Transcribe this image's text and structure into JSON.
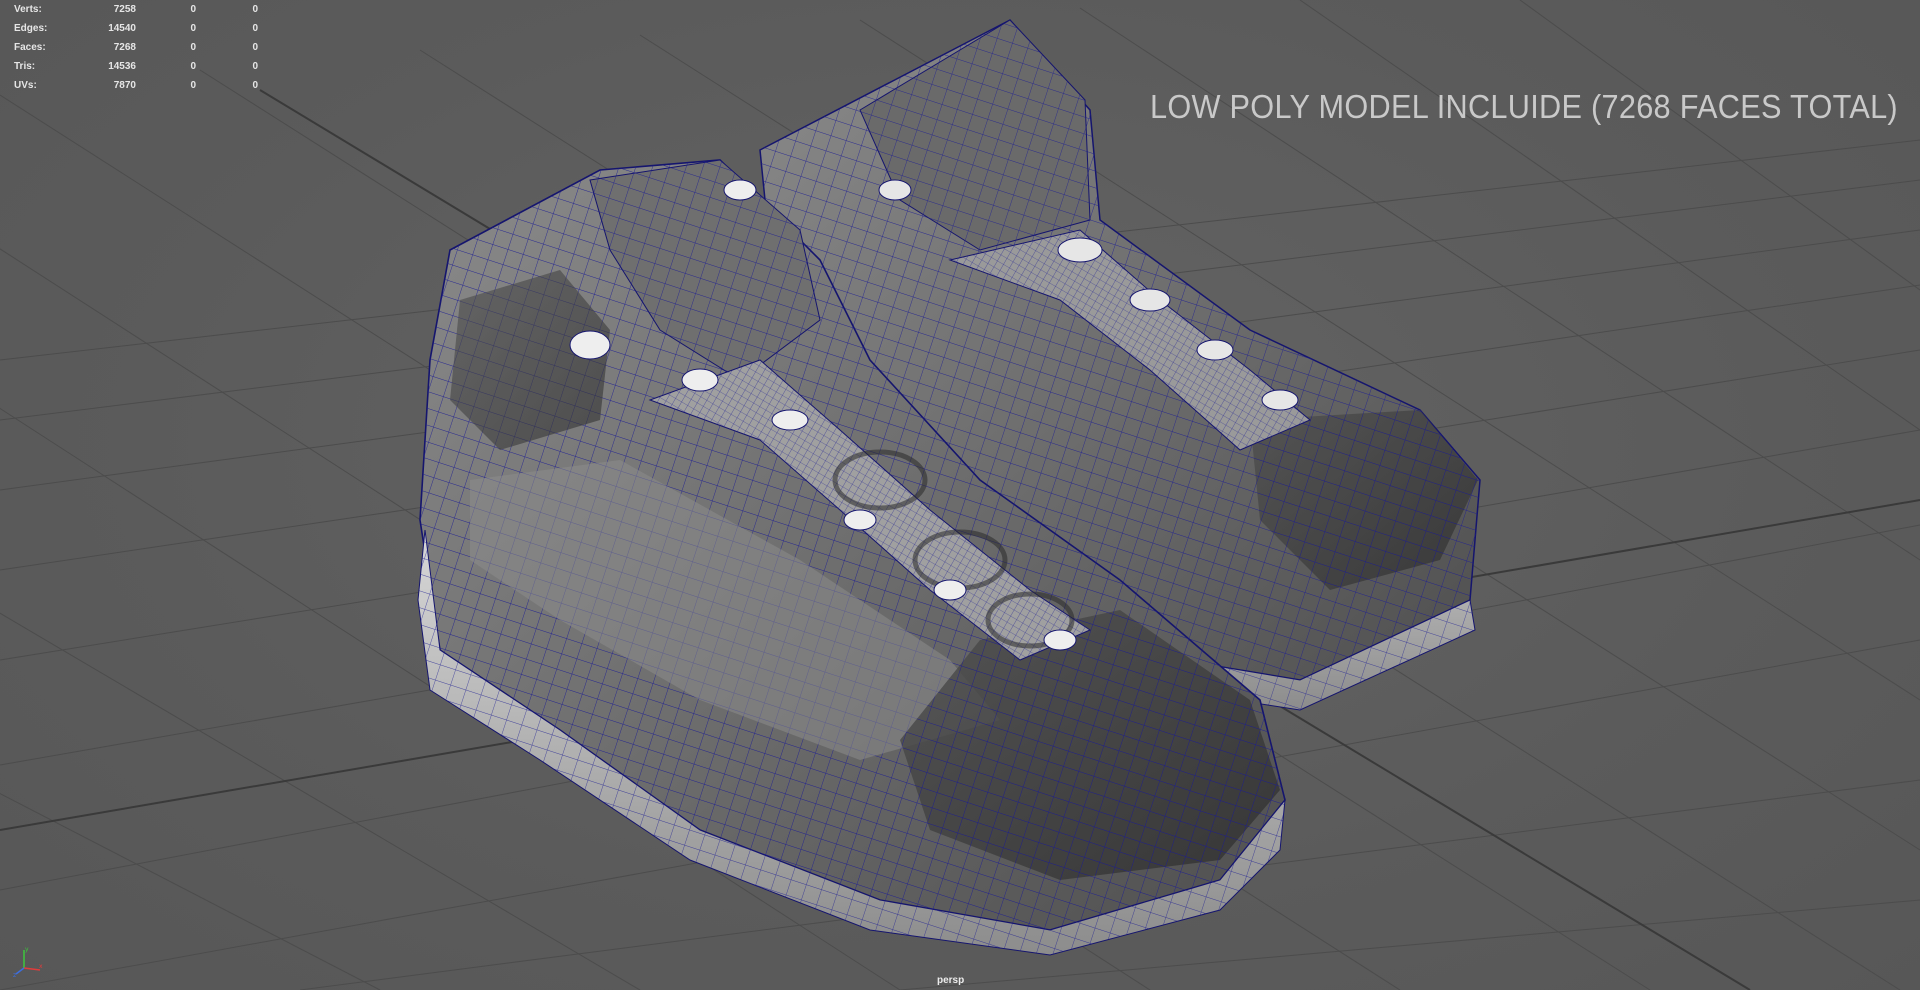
{
  "hud": {
    "rows": [
      {
        "label": "Verts:",
        "v0": "7258",
        "v1": "0",
        "v2": "0"
      },
      {
        "label": "Edges:",
        "v0": "14540",
        "v1": "0",
        "v2": "0"
      },
      {
        "label": "Faces:",
        "v0": "7268",
        "v1": "0",
        "v2": "0"
      },
      {
        "label": "Tris:",
        "v0": "14536",
        "v1": "0",
        "v2": "0"
      },
      {
        "label": "UVs:",
        "v0": "7870",
        "v1": "0",
        "v2": "0"
      }
    ]
  },
  "overlay": {
    "caption": "LOW POLY MODEL INCLUIDE (7268 FACES TOTAL)"
  },
  "viewport": {
    "camera": "persp",
    "background_color": "#5d5d5d",
    "grid_color": "#4a4a4a",
    "wire_color": "#1a1a8c"
  },
  "icons": {
    "axis": "xyz-axis-gizmo-icon",
    "model": "hiking-boots-wireframe-model"
  }
}
